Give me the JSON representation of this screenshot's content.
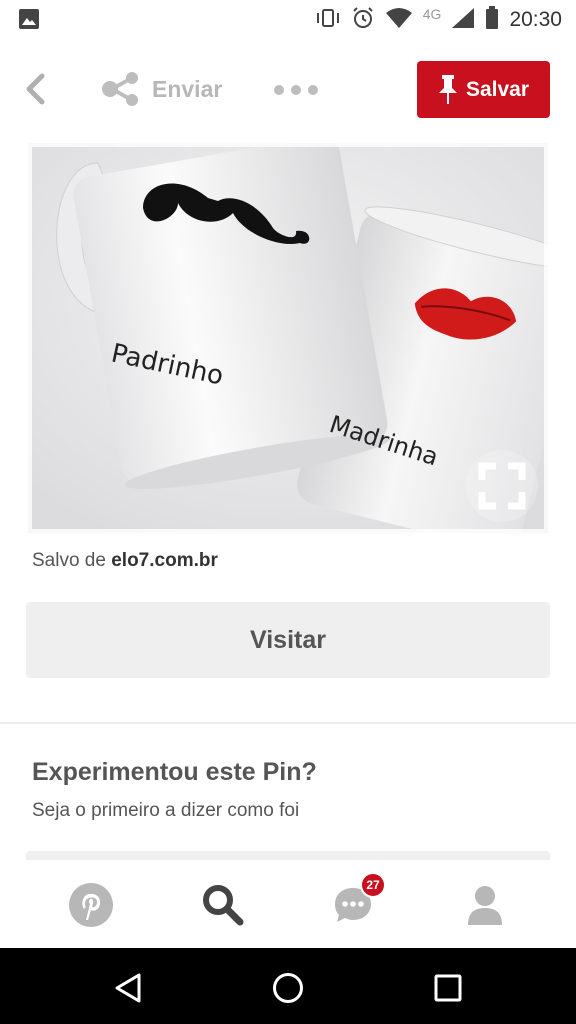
{
  "status_bar": {
    "network": "4G",
    "time": "20:30",
    "icons": [
      "image-icon",
      "vibrate-icon",
      "alarm-icon",
      "wifi-icon",
      "signal-icon",
      "battery-icon"
    ]
  },
  "toolbar": {
    "back_icon": "chevron-left-icon",
    "send_label": "Enviar",
    "send_icon": "share-icon",
    "more_icon": "more-dots-icon",
    "save_label": "Salvar",
    "save_icon": "pin-icon",
    "save_color": "#c8101f"
  },
  "pin": {
    "mug_left_text": "Padrinho",
    "mug_right_text": "Madrinha"
  },
  "source": {
    "prefix": "Salvo de",
    "domain": "elo7.com.br"
  },
  "visit": {
    "label": "Visitar"
  },
  "tried": {
    "title": "Experimentou este Pin?",
    "subtitle": "Seja o primeiro a dizer como foi"
  },
  "bottom_nav": {
    "items": [
      "pinterest-icon",
      "search-icon",
      "messages-icon",
      "profile-icon"
    ],
    "messages_badge": "27"
  },
  "system_nav": {
    "items": [
      "back-triangle-icon",
      "home-circle-icon",
      "recents-square-icon"
    ]
  }
}
